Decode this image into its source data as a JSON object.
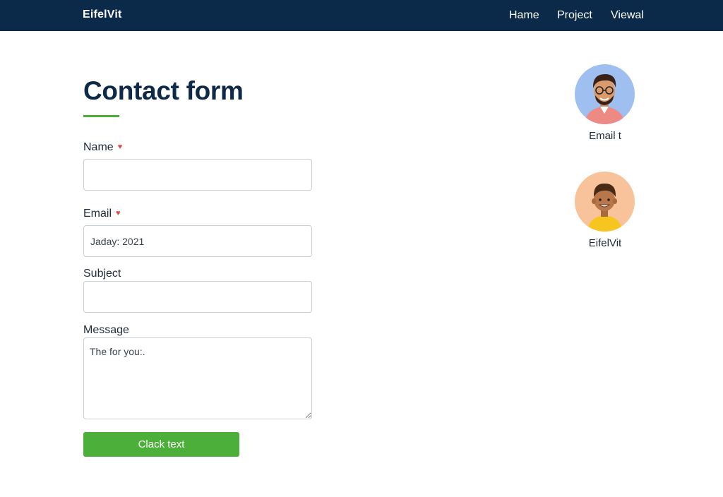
{
  "header": {
    "brand": "EifelVit",
    "nav": [
      "Hame",
      "Project",
      "Viewal"
    ]
  },
  "form": {
    "title": "Contact form",
    "name": {
      "label": "Name",
      "required_marker": "♥",
      "value": ""
    },
    "email": {
      "label": "Email",
      "required_marker": "♥",
      "value": "Jaday: 2021"
    },
    "subject": {
      "label": "Subject",
      "value": ""
    },
    "message": {
      "label": "Message",
      "value": "The for you:."
    },
    "submit_label": "Clack text"
  },
  "contacts": [
    {
      "caption": "Email t",
      "avatar_icon": "man-with-glasses-avatar"
    },
    {
      "caption": "EifelVit",
      "avatar_icon": "boy-avatar"
    }
  ],
  "colors": {
    "nav_bg": "#0b2a4a",
    "title": "#0e2a48",
    "accent_green": "#4caf3a",
    "required_red": "#e04b4b"
  }
}
